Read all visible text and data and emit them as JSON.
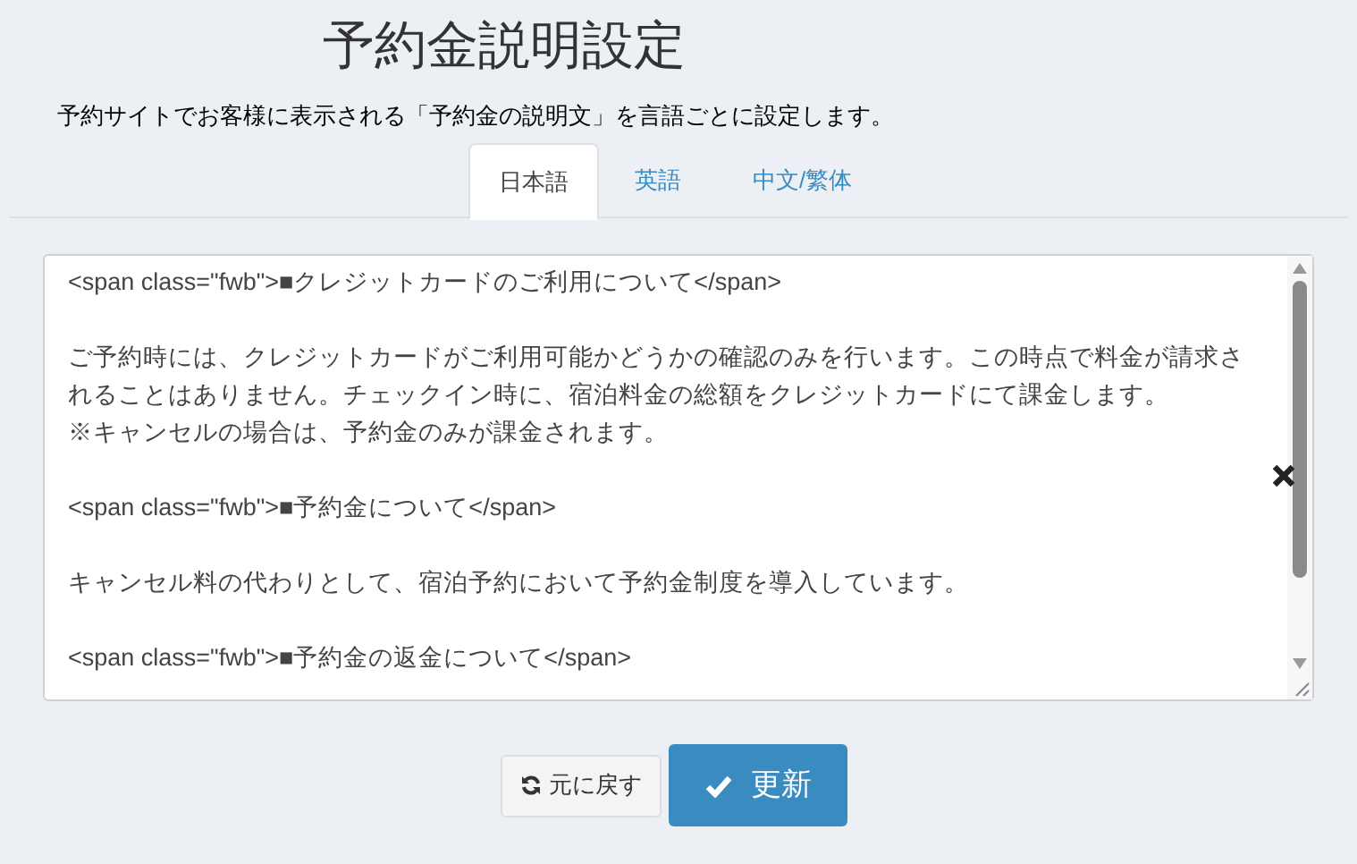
{
  "title": "予約金説明設定",
  "description": "予約サイトでお客様に表示される「予約金の説明文」を言語ごとに設定します。",
  "tabs": [
    {
      "label": "日本語",
      "selected": true
    },
    {
      "label": "英語",
      "selected": false
    },
    {
      "label": "中文/繁体",
      "selected": false
    }
  ],
  "editor": {
    "paragraphs": [
      [
        "<span class=\"fwb\">■クレジットカードのご利用について</span>"
      ],
      [
        "ご予約時には、クレジットカードがご利用可能かどうかの確認のみを行います。この時点で料金が請求さ",
        "れることはありません。チェックイン時に、宿泊料金の総額をクレジットカードにて課金します。",
        "※キャンセルの場合は、予約金のみが課金されます。"
      ],
      [
        "<span class=\"fwb\">■予約金について</span>"
      ],
      [
        "キャンセル料の代わりとして、宿泊予約において予約金制度を導入しています。"
      ],
      [
        "<span class=\"fwb\">■予約金の返金について</span>"
      ]
    ]
  },
  "buttons": [
    {
      "kind": "reset",
      "label": "元に戻す"
    },
    {
      "kind": "submit",
      "label": "更新"
    }
  ]
}
